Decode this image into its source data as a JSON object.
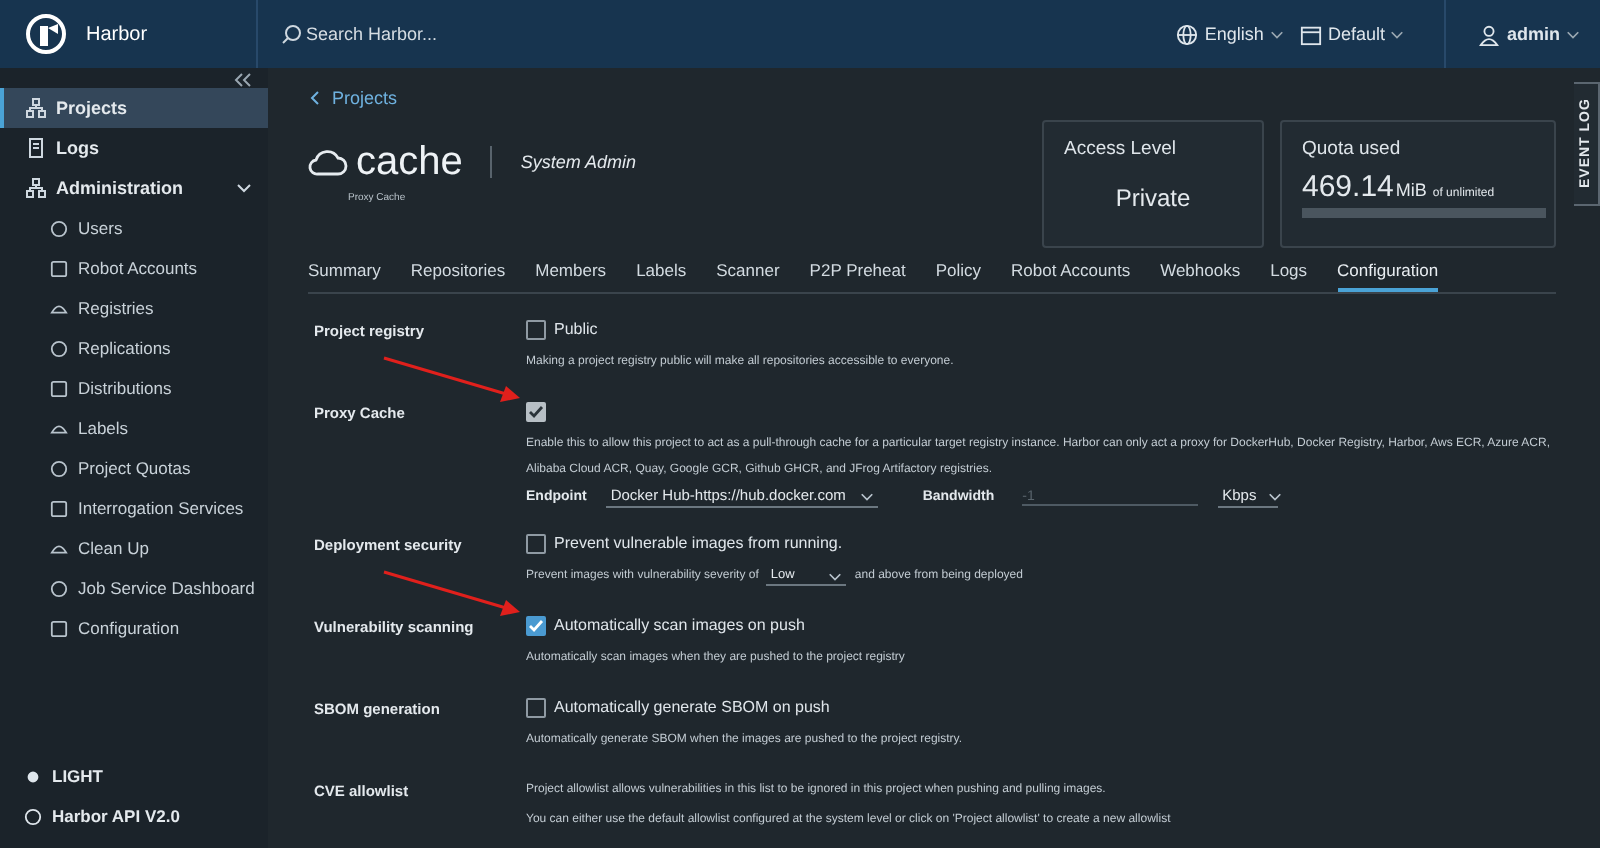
{
  "header": {
    "brand": "Harbor",
    "search_placeholder": "Search Harbor...",
    "language": "English",
    "theme": "Default",
    "user": "admin"
  },
  "sidebar": {
    "items": [
      {
        "label": "Projects",
        "selected": true
      },
      {
        "label": "Logs",
        "selected": false
      },
      {
        "label": "Administration",
        "selected": false,
        "expanded": true,
        "children": [
          {
            "label": "Users",
            "selected": false
          },
          {
            "label": "Robot Accounts",
            "selected": false
          },
          {
            "label": "Registries",
            "selected": false
          },
          {
            "label": "Replications",
            "selected": false
          },
          {
            "label": "Distributions",
            "selected": false
          },
          {
            "label": "Labels",
            "selected": false
          },
          {
            "label": "Project Quotas",
            "selected": false
          },
          {
            "label": "Interrogation Services",
            "selected": false
          },
          {
            "label": "Clean Up",
            "selected": false
          },
          {
            "label": "Job Service Dashboard",
            "selected": false
          },
          {
            "label": "Configuration",
            "selected": false
          }
        ]
      }
    ],
    "footer": [
      "LIGHT",
      "Harbor API V2.0"
    ]
  },
  "breadcrumb": "Projects",
  "project": {
    "name": "cache",
    "role": "System Admin",
    "type": "Proxy Cache"
  },
  "cards": {
    "access_title": "Access Level",
    "access_value": "Private",
    "quota_title": "Quota used",
    "quota_value": "469.14",
    "quota_unit": "MiB",
    "quota_suffix": "of unlimited"
  },
  "tabs": [
    {
      "label": "Summary",
      "selected": false
    },
    {
      "label": "Repositories",
      "selected": false
    },
    {
      "label": "Members",
      "selected": false
    },
    {
      "label": "Labels",
      "selected": false
    },
    {
      "label": "Scanner",
      "selected": false
    },
    {
      "label": "P2P Preheat",
      "selected": false
    },
    {
      "label": "Policy",
      "selected": false
    },
    {
      "label": "Robot Accounts",
      "selected": false
    },
    {
      "label": "Webhooks",
      "selected": false
    },
    {
      "label": "Logs",
      "selected": false
    },
    {
      "label": "Configuration",
      "selected": true
    }
  ],
  "config": [
    {
      "kind": "checkbox",
      "label": "Project registry",
      "checkbox_label": "Public",
      "checked": false,
      "disabled": false,
      "annotated": false,
      "help": "Making a project registry public will make all repositories accessible to everyone."
    },
    {
      "kind": "proxy",
      "label": "Proxy Cache",
      "checked": true,
      "disabled": true,
      "annotated": true,
      "help": "Enable this to allow this project to act as a pull-through cache for a particular target registry instance. Harbor can only act a proxy for DockerHub, Docker Registry, Harbor, Aws ECR, Azure ACR, Alibaba Cloud ACR, Quay, Google GCR, Github GHCR, and JFrog Artifactory registries.",
      "endpoint_label": "Endpoint",
      "endpoint": "Docker Hub-https://hub.docker.com",
      "bandwidth_label": "Bandwidth",
      "bandwidth_placeholder": "-1",
      "bandwidth_unit": "Kbps"
    },
    {
      "kind": "severity",
      "label": "Deployment security",
      "checkbox_label": "Prevent vulnerable images from running.",
      "checked": false,
      "disabled": false,
      "annotated": false,
      "help_before": "Prevent images with vulnerability severity of",
      "severity": "Low",
      "help_after": "and above from being deployed"
    },
    {
      "kind": "checkbox",
      "label": "Vulnerability scanning",
      "checkbox_label": "Automatically scan images on push",
      "checked": true,
      "disabled": false,
      "annotated": true,
      "help": "Automatically scan images when they are pushed to the project registry"
    },
    {
      "kind": "checkbox",
      "label": "SBOM generation",
      "checkbox_label": "Automatically generate SBOM on push",
      "checked": false,
      "disabled": false,
      "annotated": false,
      "help": "Automatically generate SBOM when the images are pushed to the project registry."
    },
    {
      "kind": "text",
      "label": "CVE allowlist",
      "lines": [
        "Project allowlist allows vulnerabilities in this list to be ignored in this project when pushing and pulling images.",
        "You can either use the default allowlist configured at the system level or click on 'Project allowlist' to create a new allowlist"
      ]
    }
  ],
  "event_log": "EVENT LOG"
}
